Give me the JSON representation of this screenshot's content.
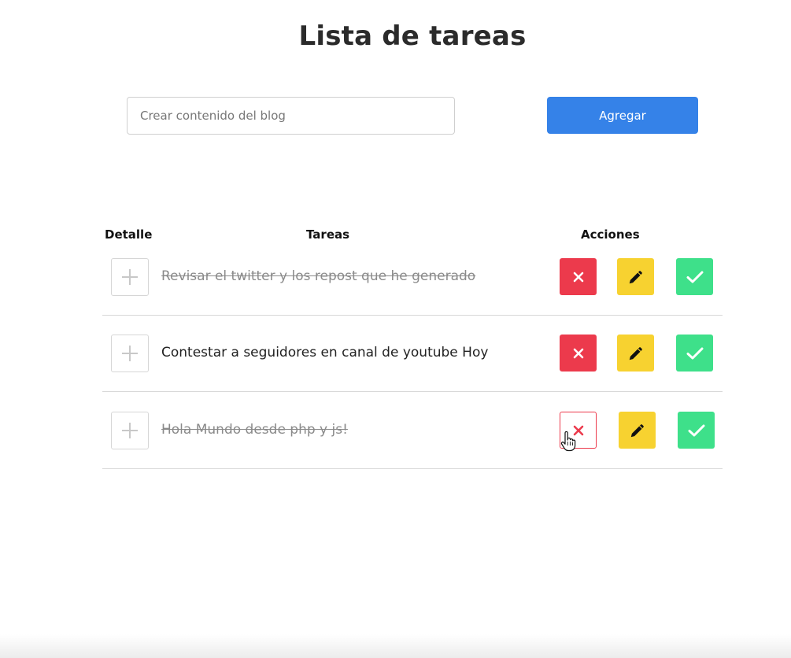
{
  "page": {
    "title": "Lista de tareas"
  },
  "form": {
    "input_value": "",
    "input_placeholder": "Crear contenido del blog",
    "add_label": "Agregar"
  },
  "table": {
    "headers": {
      "detalle": "Detalle",
      "tareas": "Tareas",
      "acciones": "Acciones"
    },
    "rows": [
      {
        "text": "Revisar el twitter y los repost que he generado",
        "completed": true
      },
      {
        "text": "Contestar a seguidores en canal de youtube Hoy",
        "completed": false
      },
      {
        "text": "Hola Mundo desde php y js!",
        "completed": true
      }
    ]
  },
  "colors": {
    "primary": "#3582e8",
    "delete": "#ec3a4c",
    "edit": "#f7d230",
    "complete": "#3ee08a"
  },
  "icons": {
    "detail": "plus-icon",
    "delete": "close-icon",
    "edit": "pencil-icon",
    "complete": "check-icon"
  }
}
